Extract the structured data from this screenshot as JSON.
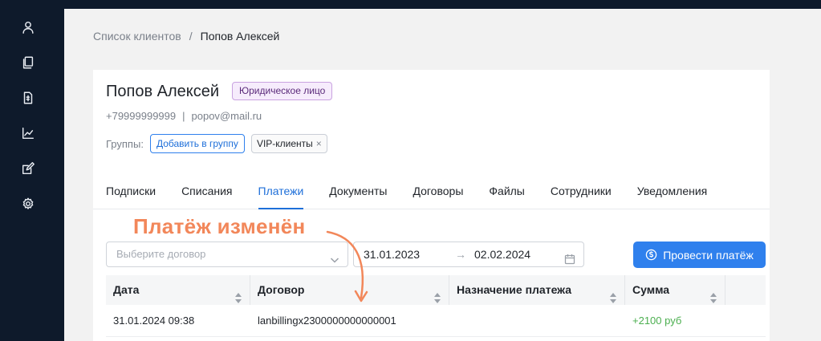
{
  "sidebar": {
    "items": [
      {
        "icon": "user-icon"
      },
      {
        "icon": "documents-icon"
      },
      {
        "icon": "invoice-icon"
      },
      {
        "icon": "chart-icon"
      },
      {
        "icon": "edit-icon"
      },
      {
        "icon": "gear-icon"
      }
    ]
  },
  "breadcrumb": {
    "parent": "Список клиентов",
    "separator": "/",
    "current": "Попов Алексей"
  },
  "client": {
    "name": "Попов Алексей",
    "type_badge": "Юридическое лицо",
    "phone": "+79999999999",
    "contact_separator": "|",
    "email": "popov@mail.ru"
  },
  "groups": {
    "label": "Группы:",
    "add_button": "Добавить в группу",
    "tags": [
      {
        "label": "VIP-клиенты",
        "close": "×"
      }
    ]
  },
  "tabs": [
    {
      "label": "Подписки",
      "active": false
    },
    {
      "label": "Списания",
      "active": false
    },
    {
      "label": "Платежи",
      "active": true
    },
    {
      "label": "Документы",
      "active": false
    },
    {
      "label": "Договоры",
      "active": false
    },
    {
      "label": "Файлы",
      "active": false
    },
    {
      "label": "Сотрудники",
      "active": false
    },
    {
      "label": "Уведомления",
      "active": false
    }
  ],
  "filters": {
    "contract_placeholder": "Выберите договор",
    "date_from": "31.01.2023",
    "date_arrow": "→",
    "date_to": "02.02.2024"
  },
  "actions": {
    "pay_button": "Провести платёж"
  },
  "table": {
    "columns": [
      "Дата",
      "Договор",
      "Назначение платежа",
      "Сумма"
    ],
    "rows": [
      {
        "date": "31.01.2024 09:38",
        "contract": "lanbillingx2300000000000001",
        "purpose": "",
        "amount": "+2100 руб"
      }
    ]
  },
  "annotation": {
    "text": "Платёж изменён"
  },
  "colors": {
    "sidebar_bg": "#0e1a2b",
    "accent": "#2f80ed",
    "annotation": "#f2875a",
    "positive_amount": "#4caf50",
    "badge_bg": "#f6ecfc"
  }
}
